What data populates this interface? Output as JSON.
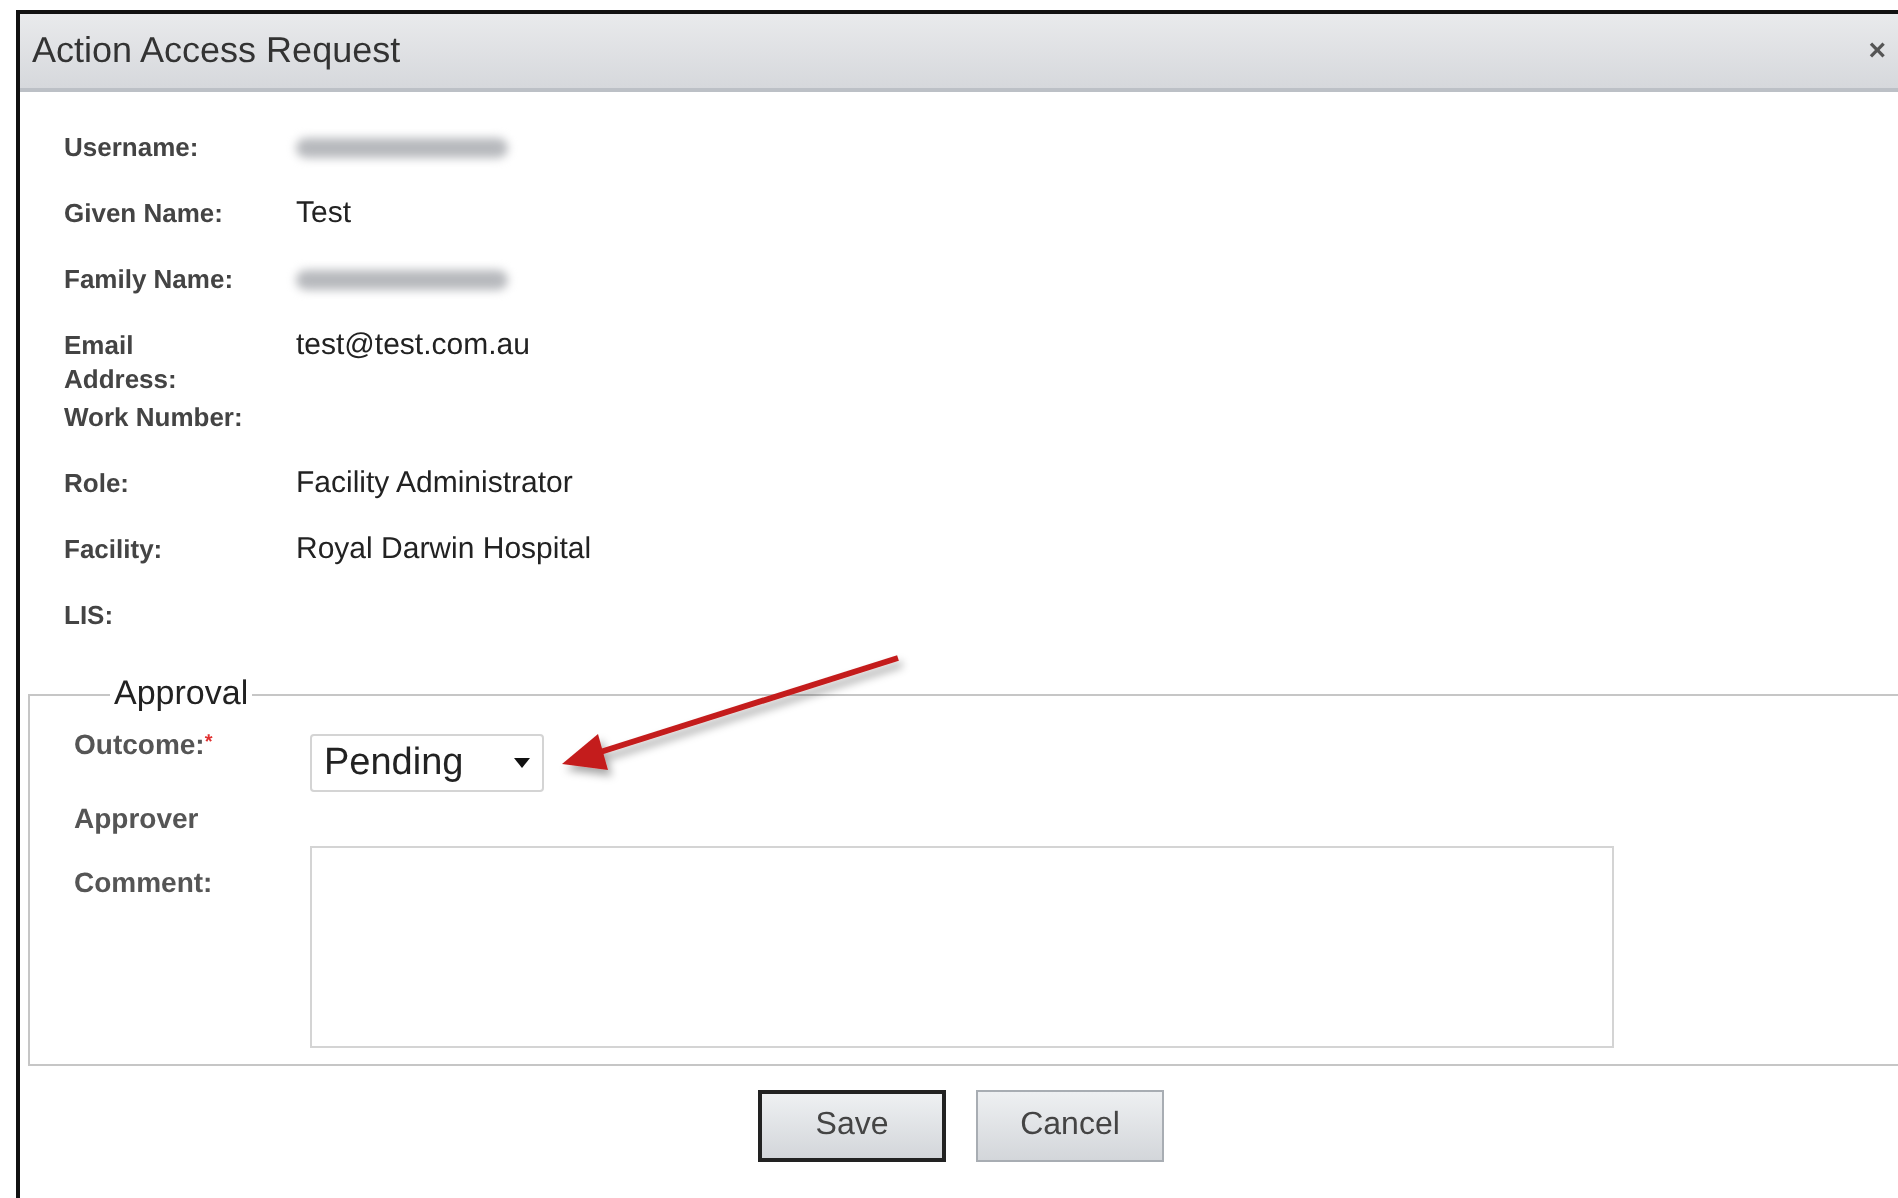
{
  "window": {
    "title": "Action Access Request",
    "close": "×"
  },
  "details": [
    {
      "label": "Username:",
      "redacted": true
    },
    {
      "label": "Given Name:",
      "value": "Test"
    },
    {
      "label": "Family Name:",
      "redacted": true
    },
    {
      "label": "Email Address:",
      "value": "test@test.com.au"
    },
    {
      "label": "Work Number:"
    },
    {
      "label": "Role:",
      "value": "Facility Administrator"
    },
    {
      "label": "Facility:",
      "value": "Royal Darwin Hospital"
    },
    {
      "label": "LIS:"
    }
  ],
  "approval": {
    "legend": "Approval",
    "outcome": {
      "label": "Outcome:",
      "required_mark": "*",
      "value": "Pending"
    },
    "approver": {
      "label": "Approver"
    },
    "comment": {
      "label": "Comment:"
    }
  },
  "annotation_arrow": true,
  "buttons": [
    {
      "label": "Save",
      "focused": true
    },
    {
      "label": "Cancel",
      "focused": false
    }
  ]
}
